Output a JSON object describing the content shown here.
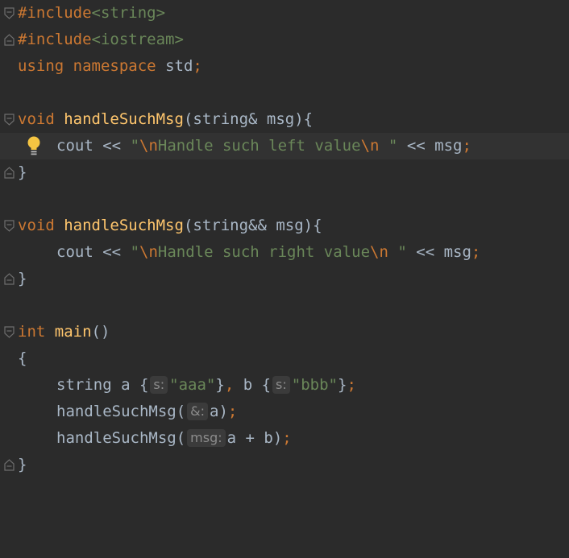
{
  "editor": {
    "colors": {
      "background": "#2b2b2b",
      "keyword": "#cc7832",
      "function": "#ffc66d",
      "string": "#6a8759",
      "text": "#a9b7c6",
      "current_line": "#323232",
      "bulb": "#f5c542"
    },
    "lines": {
      "l1": {
        "directive": "#include",
        "header": "<string>"
      },
      "l2": {
        "directive": "#include",
        "header": "<iostream>"
      },
      "l3": {
        "using": "using",
        "namespace": "namespace",
        "name": "std",
        "semi": ";"
      },
      "l5": {
        "type": "void",
        "name": "handleSuchMsg",
        "params": "(string& msg){"
      },
      "l6": {
        "cout": "cout",
        "op1": "<<",
        "q1": "\"",
        "esc1": "\\n",
        "text": "Handle such left value",
        "esc2": "\\n",
        "q2": " \"",
        "op2": "<<",
        "var": "msg",
        "semi": ";"
      },
      "l7": {
        "brace": "}"
      },
      "l9": {
        "type": "void",
        "name": "handleSuchMsg",
        "params": "(string&& msg){"
      },
      "l10": {
        "cout": "cout",
        "op1": "<<",
        "q1": "\"",
        "esc1": "\\n",
        "text": "Handle such right value",
        "esc2": "\\n",
        "q2": " \"",
        "op2": "<<",
        "var": "msg",
        "semi": ";"
      },
      "l11": {
        "brace": "}"
      },
      "l13": {
        "type": "int",
        "name": "main",
        "params": "()"
      },
      "l14": {
        "brace": "{"
      },
      "l15": {
        "type": "string",
        "a": "a {",
        "hint1": "s:",
        "val1": "\"aaa\"",
        "close1": "}",
        "comma": ",",
        "b": "b {",
        "hint2": "s:",
        "val2": "\"bbb\"",
        "close2": "}",
        "semi": ";"
      },
      "l16": {
        "call": "handleSuchMsg(",
        "hint": "&:",
        "arg": "a)",
        "semi": ";"
      },
      "l17": {
        "call": "handleSuchMsg(",
        "hint": "msg:",
        "arg": "a + b)",
        "semi": ";"
      },
      "l18": {
        "brace": "}"
      }
    },
    "icons": {
      "fold": "fold-marker-icon",
      "bulb": "lightbulb-icon"
    }
  }
}
